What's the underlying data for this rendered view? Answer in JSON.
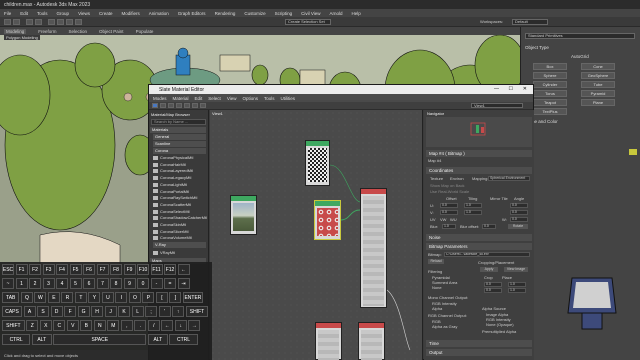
{
  "window": {
    "title": "children.max - Autodesk 3ds Max 2023"
  },
  "main_menu": [
    "File",
    "Edit",
    "Tools",
    "Group",
    "Views",
    "Create",
    "Modifiers",
    "Animation",
    "Graph Editors",
    "Rendering",
    "Customize",
    "Scripting",
    "Civil View",
    "Arnold",
    "Help"
  ],
  "main_toolbar": {
    "selection_set": "Create Selection Set",
    "workspace_label": "Workspaces:",
    "workspace_value": "Default"
  },
  "ribbon": {
    "tabs": [
      "Modeling",
      "Freeform",
      "Selection",
      "Object Paint",
      "Populate"
    ],
    "sub": "Polygon Modeling"
  },
  "command_panel": {
    "search": "Standard Primitives",
    "object_type": "Object Type",
    "autogrid": "AutoGrid",
    "buttons": [
      "Box",
      "Cone",
      "Sphere",
      "GeoSphere",
      "Cylinder",
      "Tube",
      "Torus",
      "Pyramid",
      "Teapot",
      "Plane",
      "TextPlus"
    ],
    "name_color": "Name and Color"
  },
  "sme": {
    "title": "Slate Material Editor",
    "menu": [
      "Modes",
      "Material",
      "Edit",
      "Select",
      "View",
      "Options",
      "Tools",
      "Utilities"
    ],
    "browser_title": "Material/Map Browser",
    "search": "Search by Name ...",
    "sections": [
      "Materials",
      "General",
      "Scanline",
      "Corona"
    ],
    "corona_items": [
      "CoronaPhysicalMtl",
      "CoronaHairMtl",
      "CoronaLayeredMtl",
      "CoronaLegacyMtl",
      "CoronaLightMtl",
      "CoronaPortalMtl",
      "CoronaRaySwitchMtl",
      "CoronaScatterMtl",
      "CoronaSelectMtl",
      "CoronaShadowCatcherMtl",
      "CoronaSkinMtl",
      "CoronaSlicerMtl",
      "CoronaVolumeMtl"
    ],
    "vray_section": "V-Ray",
    "vray_items": [
      "VRayMtl"
    ],
    "maps_section": "Maps",
    "view_tab": "View1",
    "navigator": "Navigator",
    "view_dropdown": "View1",
    "node_panel_header": "Map #4 ( Bitmap )",
    "node_panel_sub": "Map #4",
    "coordinates": {
      "header": "Coordinates",
      "texture": "Texture",
      "environ": "Environ",
      "mapping_label": "Mapping:",
      "mapping_value": "Spherical Environment",
      "show_map": "Show Map on Back",
      "realworld": "Use Real-World Scale",
      "offset": "Offset",
      "tiling": "Tiling",
      "mirror_tile": "Mirror Tile",
      "angle": "Angle",
      "u": "U:",
      "v": "V:",
      "w": "W:",
      "u_offset": "0.0",
      "v_offset": "0.0",
      "u_tiling": "1.0",
      "v_tiling": "1.0",
      "u_angle": "0.0",
      "v_angle": "0.0",
      "w_angle": "0.0",
      "uv": "UV",
      "vw": "VW",
      "wu": "WU",
      "blur": "Blur:",
      "blur_val": "1.0",
      "blur_offset": "Blur offset:",
      "blur_offset_val": "0.0",
      "rotate": "Rotate"
    },
    "noise": "Noise",
    "bitmap_params": {
      "header": "Bitmap Parameters",
      "bitmap_label": "Bitmap:",
      "bitmap_path": "C:\\Users\\...\\lakeside_4k.exr",
      "reload": "Reload",
      "cropping": "Cropping/Placement",
      "apply": "Apply",
      "view_image": "View Image",
      "crop": "Crop",
      "place": "Place",
      "filtering": "Filtering",
      "pyramidal": "Pyramidal",
      "summed_area": "Summed Area",
      "none": "None",
      "mono_output": "Mono Channel Output:",
      "rgb_intensity": "RGB Intensity",
      "alpha": "Alpha",
      "rgb_output": "RGB Channel Output:",
      "rgb": "RGB",
      "alpha_gray": "Alpha as Gray",
      "alpha_source": "Alpha Source",
      "image_alpha": "Image Alpha",
      "rgb_intensity2": "RGB Intensity",
      "none_opaque": "None (Opaque)",
      "premultiplied": "Premultiplied Alpha",
      "u_val": "0.0",
      "v_val": "0.0",
      "w_val": "1.0",
      "h_val": "1.0"
    },
    "time": "Time",
    "output": "Output"
  },
  "status": {
    "text": "Click and drag to select and move objects"
  },
  "osk": {
    "row1": [
      "ESC",
      "F1",
      "F2",
      "F3",
      "F4",
      "F5",
      "F6",
      "F7",
      "F8",
      "F9",
      "F10",
      "F11",
      "F12",
      "←"
    ],
    "row2": [
      "~",
      "1",
      "2",
      "3",
      "4",
      "5",
      "6",
      "7",
      "8",
      "9",
      "0",
      "-",
      "=",
      "⇥"
    ],
    "row3": [
      "TAB",
      "Q",
      "W",
      "E",
      "R",
      "T",
      "Y",
      "U",
      "I",
      "O",
      "P",
      "[",
      "]",
      "ENTER"
    ],
    "row4": [
      "CAPS",
      "A",
      "S",
      "D",
      "F",
      "G",
      "H",
      "J",
      "K",
      "L",
      ";",
      "'",
      "↑",
      "SHIFT"
    ],
    "row5": [
      "SHIFT",
      "Z",
      "X",
      "C",
      "V",
      "B",
      "N",
      "M",
      ",",
      ".",
      "/",
      "←",
      "↓",
      "→"
    ],
    "row6": [
      "CTRL",
      "ALT",
      "SPACE",
      "ALT",
      "CTRL"
    ]
  },
  "colors": {
    "node_green": "#3ea860",
    "node_red": "#c84a4a",
    "accent": "#5b8fd6"
  }
}
